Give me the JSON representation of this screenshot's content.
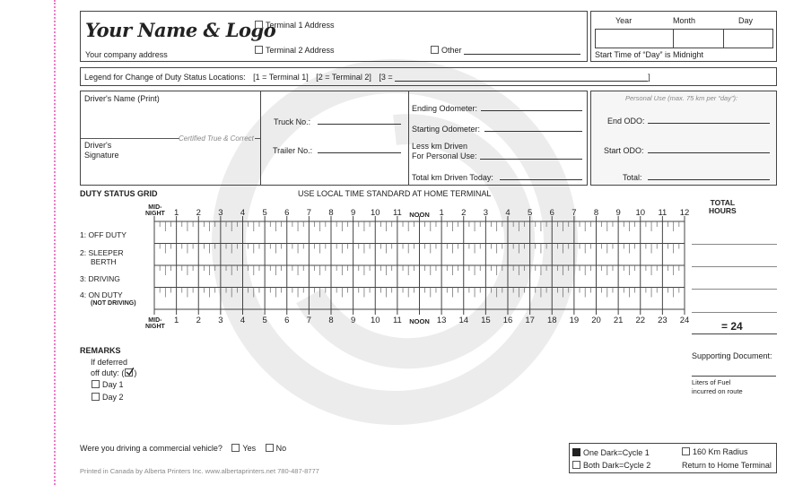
{
  "header": {
    "logo_text": "Your Name & Logo",
    "company_address": "Your company address",
    "terminal1_label": "Terminal 1 Address",
    "terminal2_label": "Terminal 2 Address",
    "other_label": "Other",
    "date_year": "Year",
    "date_month": "Month",
    "date_day": "Day",
    "start_time_note": "Start Time of “Day” is Midnight"
  },
  "legend": {
    "label": "Legend for Change of Duty Status Locations:",
    "item1": "[1 = Terminal 1]",
    "item2": "[2 = Terminal 2]",
    "item3_prefix": "[3 =",
    "item3_suffix": "]"
  },
  "driver": {
    "name_label": "Driver's Name (Print)",
    "certified": "Certified True & Correct",
    "signature_label_1": "Driver's",
    "signature_label_2": "Signature",
    "truck_label": "Truck No.:",
    "trailer_label": "Trailer No.:",
    "ending_odo_label": "Ending Odometer:",
    "starting_odo_label": "Starting Odometer:",
    "less_km_label_1": "Less km Driven",
    "less_km_label_2": "For Personal Use:",
    "total_km_label": "Total km Driven Today:"
  },
  "personal_use": {
    "title": "Personal Use (max. 75 km per “day”):",
    "end_odo_label": "End ODO:",
    "start_odo_label": "Start ODO:",
    "total_label": "Total:"
  },
  "grid": {
    "title": "DUTY STATUS GRID",
    "subtitle": "USE LOCAL TIME STANDARD AT HOME TERMINAL",
    "midnight_1": "MID-",
    "midnight_2": "NIGHT",
    "top_labels": [
      "1",
      "2",
      "3",
      "4",
      "5",
      "6",
      "7",
      "8",
      "9",
      "10",
      "11",
      "NOON",
      "1",
      "2",
      "3",
      "4",
      "5",
      "6",
      "7",
      "8",
      "9",
      "10",
      "11",
      "12"
    ],
    "bottom_labels": [
      "1",
      "2",
      "3",
      "4",
      "5",
      "6",
      "7",
      "8",
      "9",
      "10",
      "11",
      "NOON",
      "13",
      "14",
      "15",
      "16",
      "17",
      "18",
      "19",
      "20",
      "21",
      "22",
      "23",
      "24"
    ],
    "rows": [
      {
        "line1": "1:  OFF DUTY",
        "line2": ""
      },
      {
        "line1": "2:  SLEEPER",
        "line2": "BERTH"
      },
      {
        "line1": "3:  DRIVING",
        "line2": ""
      },
      {
        "line1": "4: ON DUTY",
        "line2": "(NOT DRIVING)"
      }
    ],
    "total_hours_1": "TOTAL",
    "total_hours_2": "HOURS",
    "total_sum": "= 24"
  },
  "remarks": {
    "title": "REMARKS",
    "deferred_1": "If deferred",
    "deferred_2": "off duty: (",
    "deferred_3": ")",
    "day1": "Day 1",
    "day2": "Day 2",
    "supporting_doc": "Supporting Document:",
    "fuel_1": "Liters of Fuel",
    "fuel_2": "incurred on route"
  },
  "footer": {
    "commercial_question": "Were you driving a commercial vehicle?",
    "yes": "Yes",
    "no": "No",
    "printed_by": "Printed in Canada by Alberta Printers Inc. www.albertaprinters.net 780-487-8777",
    "cycle1": "One Dark=Cycle 1",
    "cycle2": "Both Dark=Cycle 2",
    "radius": "160 Km Radius",
    "return_home": "Return to Home Terminal"
  },
  "colors": {
    "perforation": "#f07ac8",
    "watermark": "#ececec",
    "personal_bg": "#f4f4f4"
  }
}
